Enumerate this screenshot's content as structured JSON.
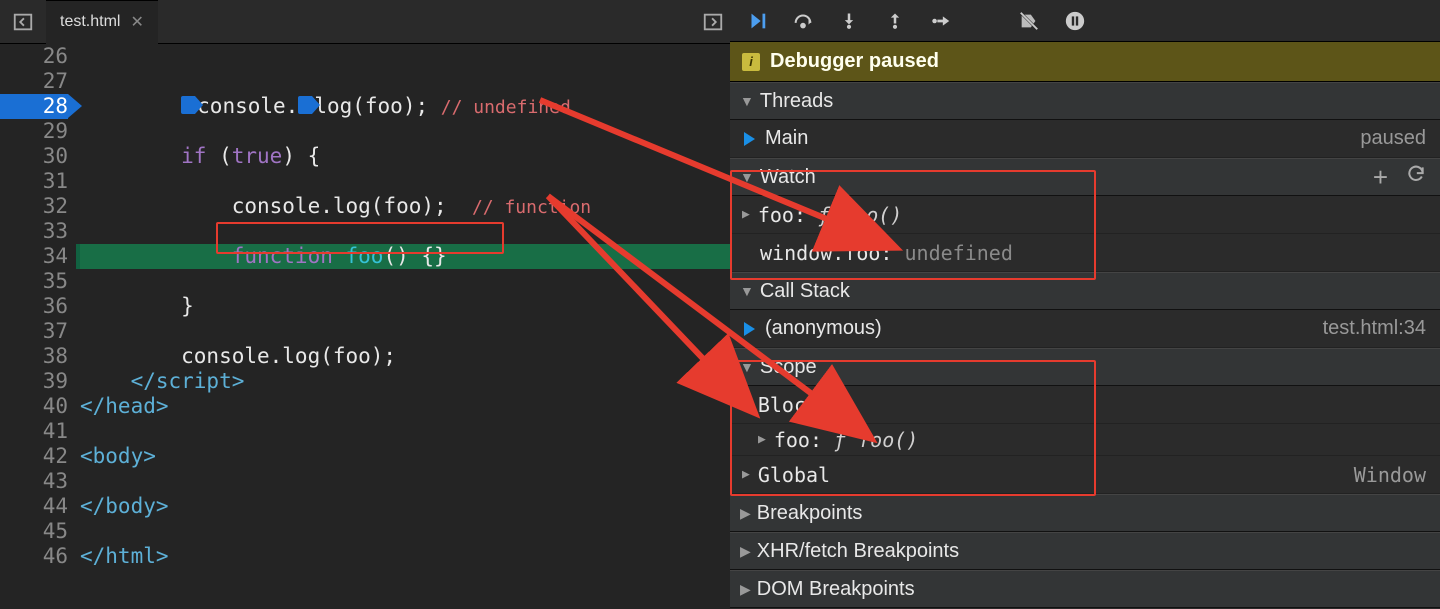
{
  "tab": {
    "filename": "test.html"
  },
  "gutter": {
    "start": 26,
    "end": 46,
    "breakpoint_line": 28,
    "exec_line": 34
  },
  "code": {
    "l28_console": "console.",
    "l28_log": "log",
    "l28_arg": "(foo);",
    "l28_cmt": "// undefined",
    "l30_if": "if",
    "l30_rest": " (",
    "l30_true": "true",
    "l30_close": ") {",
    "l32": "console.log(foo);",
    "l32_cmt": "// function",
    "l34_fn": "function",
    "l34_name": " foo",
    "l34_rest": "() {}",
    "l36": "}",
    "l38": "console.log(foo);",
    "l39": "</script>",
    "l40": "</head>",
    "l42": "<body>",
    "l44": "</body>",
    "l46": "</html>"
  },
  "debugger": {
    "banner": "Debugger paused",
    "sections": {
      "threads": "Threads",
      "watch": "Watch",
      "callstack": "Call Stack",
      "scope": "Scope",
      "breakpoints": "Breakpoints",
      "xhr": "XHR/fetch Breakpoints",
      "dom": "DOM Breakpoints"
    },
    "thread_main": {
      "name": "Main",
      "state": "paused"
    },
    "watch": {
      "foo_label": "foo:",
      "foo_val": "ƒ foo()",
      "winfoo_label": "window.foo:",
      "winfoo_val": "undefined"
    },
    "callstack": {
      "frame": "(anonymous)",
      "loc": "test.html:34"
    },
    "scope": {
      "block": "Block",
      "block_foo_label": "foo:",
      "block_foo_val": "ƒ foo()",
      "global": "Global",
      "global_val": "Window"
    }
  }
}
